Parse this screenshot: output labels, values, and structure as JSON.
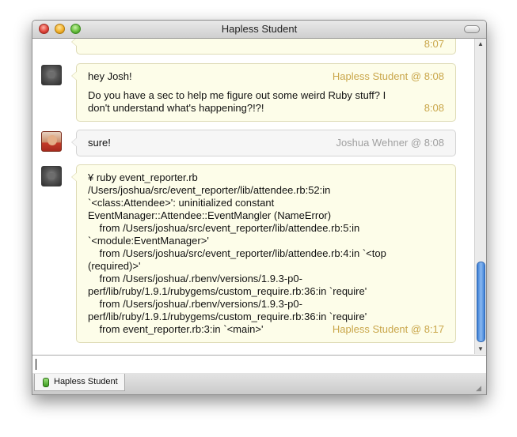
{
  "window": {
    "title": "Hapless Student"
  },
  "messages": [
    {
      "stamp": "8:07"
    },
    {
      "line1": "hey Josh!",
      "header": "Hapless Student @ 8:08",
      "body": "Do you have a sec to help me figure out some weird Ruby stuff? I\ndon't understand what's happening?!?!",
      "time": "8:08"
    },
    {
      "text": "sure!",
      "header": "Joshua Wehner @ 8:08"
    },
    {
      "body": "¥ ruby event_reporter.rb\n/Users/joshua/src/event_reporter/lib/attendee.rb:52:in\n`<class:Attendee>': uninitialized constant\nEventManager::Attendee::EventMangler (NameError)\n    from /Users/joshua/src/event_reporter/lib/attendee.rb:5:in\n`<module:EventManager>'\n    from /Users/joshua/src/event_reporter/lib/attendee.rb:4:in `<top\n(required)>'\n    from /Users/joshua/.rbenv/versions/1.9.3-p0-\nperf/lib/ruby/1.9.1/rubygems/custom_require.rb:36:in `require'\n    from /Users/joshua/.rbenv/versions/1.9.3-p0-\nperf/lib/ruby/1.9.1/rubygems/custom_require.rb:36:in `require'\n    from event_reporter.rb:3:in `<main>'",
      "header": "Hapless Student @ 8:17"
    }
  ],
  "tab": {
    "label": "Hapless Student"
  },
  "colors": {
    "bubble_yellow": "#fdfde9",
    "bubble_gray": "#f6f6f6",
    "stamp_gold": "#c9a64a",
    "stamp_gray": "#a0a0a0",
    "scroll_blue": "#3c7fd6"
  }
}
